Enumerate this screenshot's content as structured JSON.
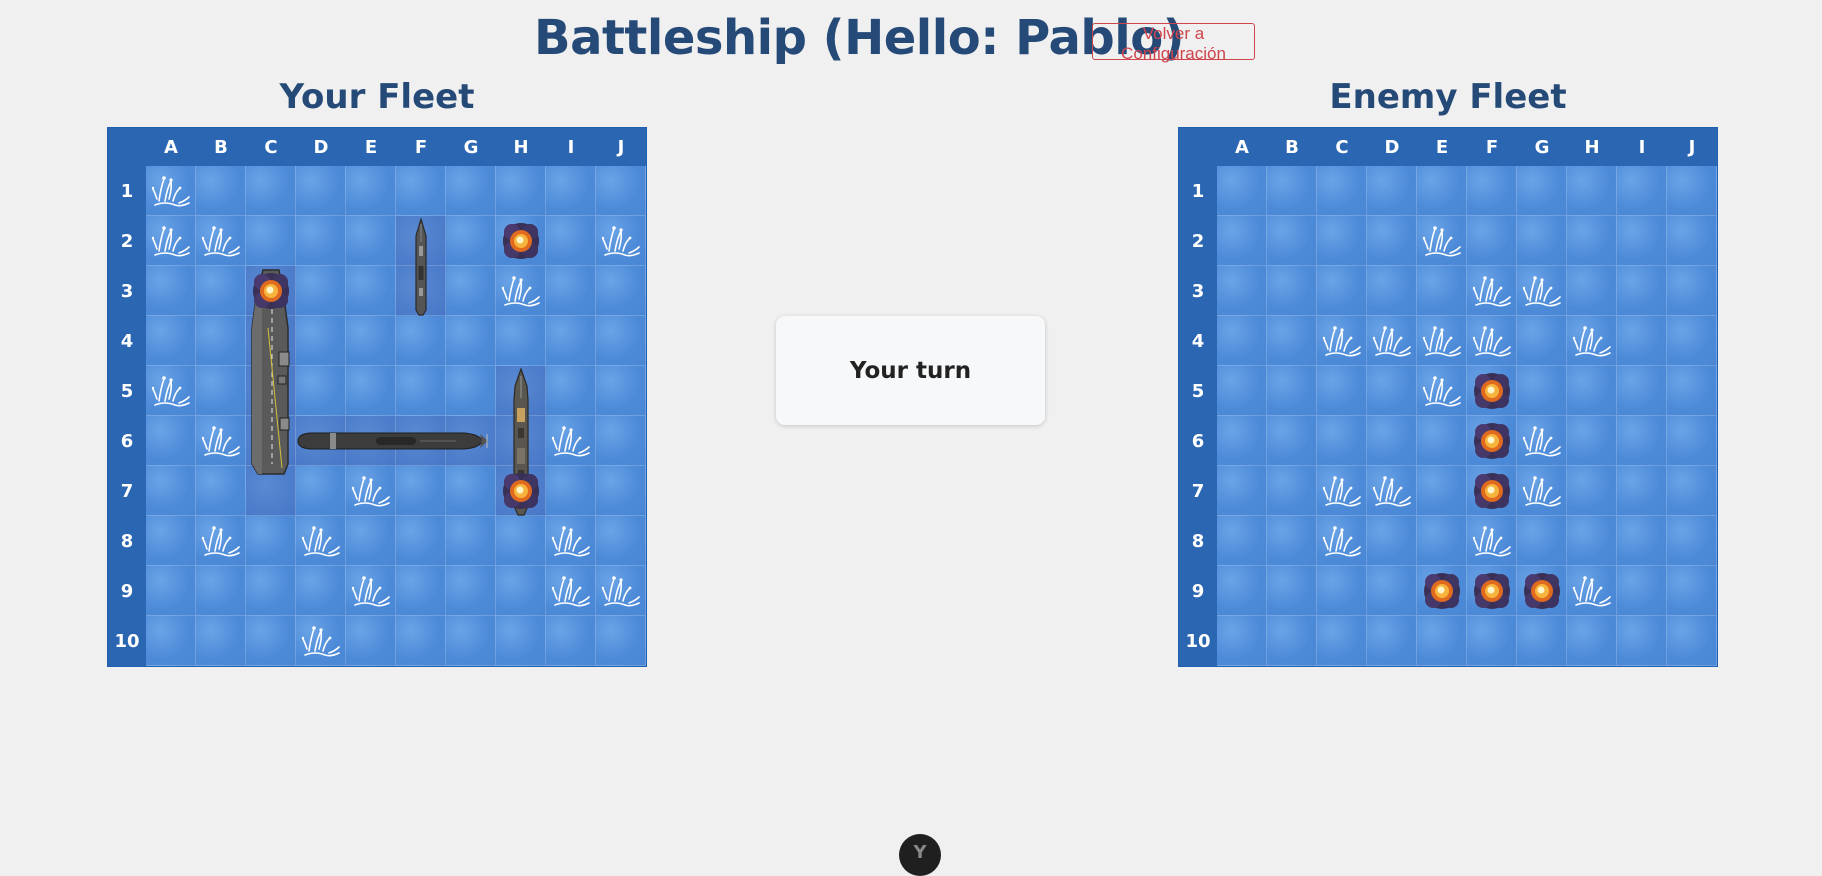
{
  "header": {
    "title": "Battleship (Hello: Pablo)",
    "back_button": "Volver a Configuración"
  },
  "columns": [
    "A",
    "B",
    "C",
    "D",
    "E",
    "F",
    "G",
    "H",
    "I",
    "J"
  ],
  "rows": [
    "1",
    "2",
    "3",
    "4",
    "5",
    "6",
    "7",
    "8",
    "9",
    "10"
  ],
  "player_board": {
    "title": "Your Fleet",
    "ships": [
      {
        "name": "carrier",
        "orientation": "vertical",
        "start": "C3",
        "length": 5
      },
      {
        "name": "destroyer",
        "orientation": "vertical",
        "start": "F2",
        "length": 2
      },
      {
        "name": "battleship",
        "orientation": "vertical",
        "start": "H5",
        "length": 3
      },
      {
        "name": "submarine",
        "orientation": "horizontal",
        "start": "D6",
        "length": 4
      }
    ],
    "misses": [
      "A1",
      "A2",
      "B2",
      "J2",
      "H3",
      "A5",
      "B6",
      "I6",
      "E7",
      "B8",
      "D8",
      "I8",
      "E9",
      "I9",
      "J9",
      "D10"
    ],
    "hits": [
      "H2",
      "C3",
      "H7"
    ]
  },
  "enemy_board": {
    "title": "Enemy Fleet",
    "misses": [
      "E2",
      "F3",
      "G3",
      "C4",
      "D4",
      "E4",
      "F4",
      "H4",
      "E5",
      "G6",
      "C7",
      "D7",
      "G7",
      "C8",
      "F8",
      "H9"
    ],
    "hits": [
      "F5",
      "F6",
      "F7",
      "E9",
      "F9",
      "G9"
    ]
  },
  "status": {
    "text": "Your turn"
  },
  "bottom_button": {
    "label": "Y"
  },
  "colors": {
    "title": "#254a78",
    "accent_red": "#d0454c",
    "board_header": "#2a66b2",
    "water": "#4a86d4"
  },
  "icons": {
    "miss": "splash-icon",
    "hit": "explosion-icon"
  }
}
